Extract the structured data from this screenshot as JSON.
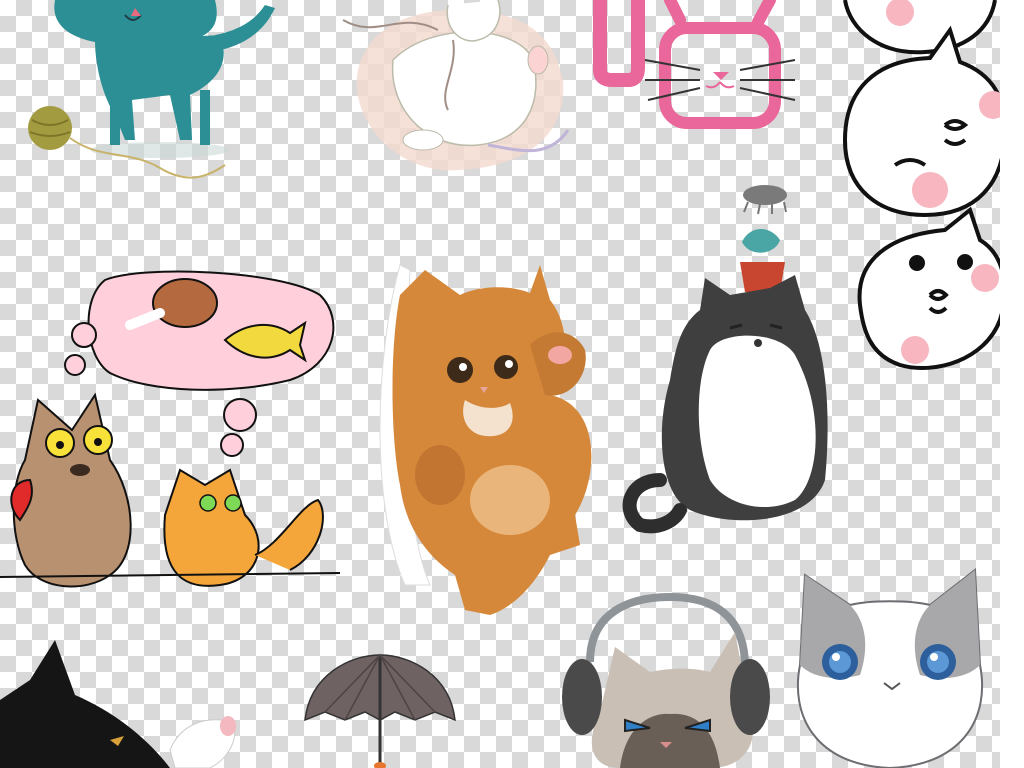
{
  "collage": {
    "background": "transparency-checkerboard",
    "stickers": [
      {
        "name": "teal-cat-with-yarn",
        "color": "#2c8f95"
      },
      {
        "name": "sleeping-cat-with-yarn",
        "color": "#f1e8e5"
      },
      {
        "name": "pink-cat-face-doodle",
        "color": "#e9679a"
      },
      {
        "name": "white-cats-stack",
        "color": "#ffffff"
      },
      {
        "name": "dreaming-cats-doodle",
        "color": "#ffb6c8"
      },
      {
        "name": "orange-kitten-peeking",
        "color": "#d5883a"
      },
      {
        "name": "fat-cat-with-plant",
        "color": "#3f3f3f"
      },
      {
        "name": "black-cat-with-mouse",
        "color": "#151515"
      },
      {
        "name": "umbrella",
        "color": "#6f6262"
      },
      {
        "name": "grumpy-cat-headphones",
        "color": "#6a5f57"
      },
      {
        "name": "gray-kitten",
        "color": "#a8a8ab"
      }
    ]
  }
}
